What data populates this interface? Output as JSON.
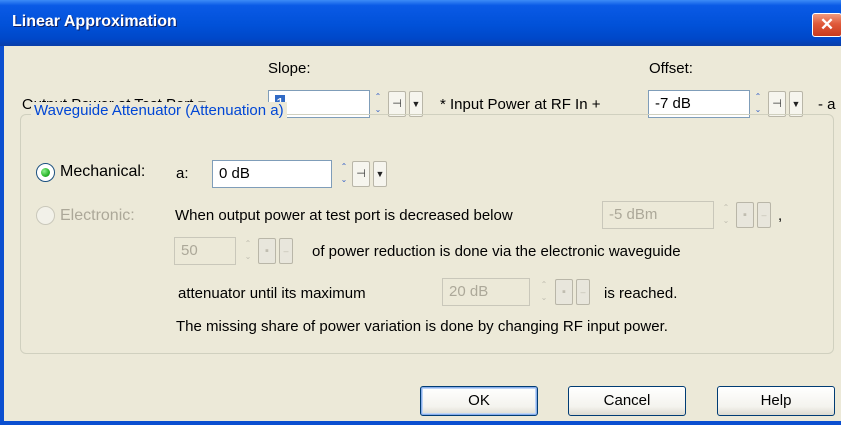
{
  "window": {
    "title": "Linear Approximation",
    "close_glyph": "✕"
  },
  "equation": {
    "output_label": "Output Power at Test Port  =",
    "slope_label": "Slope:",
    "slope_value": "1",
    "input_label": "* Input Power at RF In  +",
    "offset_label": "Offset:",
    "offset_value": "-7 dB",
    "trailing_text": "- a"
  },
  "group": {
    "title": "Waveguide Attenuator (Attenuation a)",
    "mechanical_label": "Mechanical:",
    "a_label": "a:",
    "a_value": "0 dB",
    "electronic_label": "Electronic:",
    "electronic_text1": "When output power at test port is decreased below",
    "threshold_value": "-5 dBm",
    "comma": ",",
    "percent_value": "50",
    "electronic_text2": "of power reduction is done via the electronic waveguide",
    "electronic_text3": "attenuator until its maximum",
    "max_value": "20 dB",
    "electronic_text4": "is reached.",
    "electronic_text5": "The missing share of power variation is done by changing RF input power.",
    "mechanical_selected": true
  },
  "buttons": {
    "ok": "OK",
    "cancel": "Cancel",
    "help": "Help"
  },
  "icons": {
    "spin_up": "⌃",
    "spin_down": "⌄",
    "step_glyph": "⊣",
    "dropdown_glyph": "▼",
    "disabled_step_glyph": "▪",
    "disabled_dropdown_glyph": "–"
  },
  "colors": {
    "title_bar": "#0151d8",
    "dialog_bg": "#ece9d8",
    "group_title": "#0046d5",
    "selection": "#316ac5",
    "disabled_text": "#aca899"
  }
}
